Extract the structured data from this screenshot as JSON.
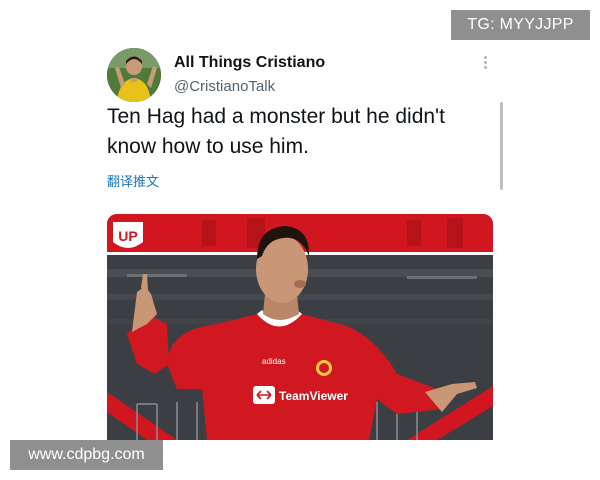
{
  "watermarks": {
    "top": "TG: MYYJJPP",
    "bottom": "www.cdpbg.com"
  },
  "tweet": {
    "author": {
      "display_name": "All Things Cristiano",
      "handle": "@CristianoTalk"
    },
    "text": "Ten Hag had a monster but he didn't know how to use him.",
    "translate_label": "翻译推文",
    "more_icon": "more-dots-icon"
  },
  "media": {
    "logo_text": "UP",
    "jersey_sponsor": "TeamViewer",
    "jersey_brand": "adidas",
    "colors": {
      "banner": "#d2161f",
      "jersey": "#d11820",
      "background": "#3a3a3a"
    }
  }
}
